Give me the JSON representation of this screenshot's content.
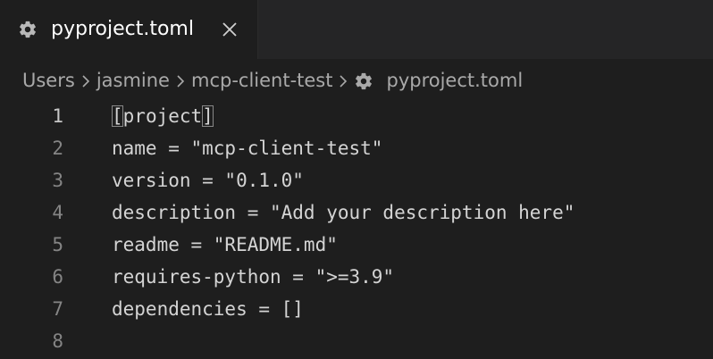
{
  "tab": {
    "title": "pyproject.toml",
    "icon": "gear-icon",
    "close_icon": "close-icon"
  },
  "breadcrumb": {
    "items": [
      "Users",
      "jasmine",
      "mcp-client-test",
      "pyproject.toml"
    ]
  },
  "editor": {
    "active_line": 1,
    "lines": [
      {
        "number": "1",
        "text": "[project]"
      },
      {
        "number": "2",
        "text": "name = \"mcp-client-test\""
      },
      {
        "number": "3",
        "text": "version = \"0.1.0\""
      },
      {
        "number": "4",
        "text": "description = \"Add your description here\""
      },
      {
        "number": "5",
        "text": "readme = \"README.md\""
      },
      {
        "number": "6",
        "text": "requires-python = \">=3.9\""
      },
      {
        "number": "7",
        "text": "dependencies = []"
      },
      {
        "number": "8",
        "text": ""
      }
    ]
  },
  "colors": {
    "background": "#1e1e1e",
    "tabbar": "#252526",
    "text": "#d4d4d4",
    "line_number": "#858585",
    "active_line_number": "#c6c6c6",
    "breadcrumb": "#a9a9a9"
  }
}
